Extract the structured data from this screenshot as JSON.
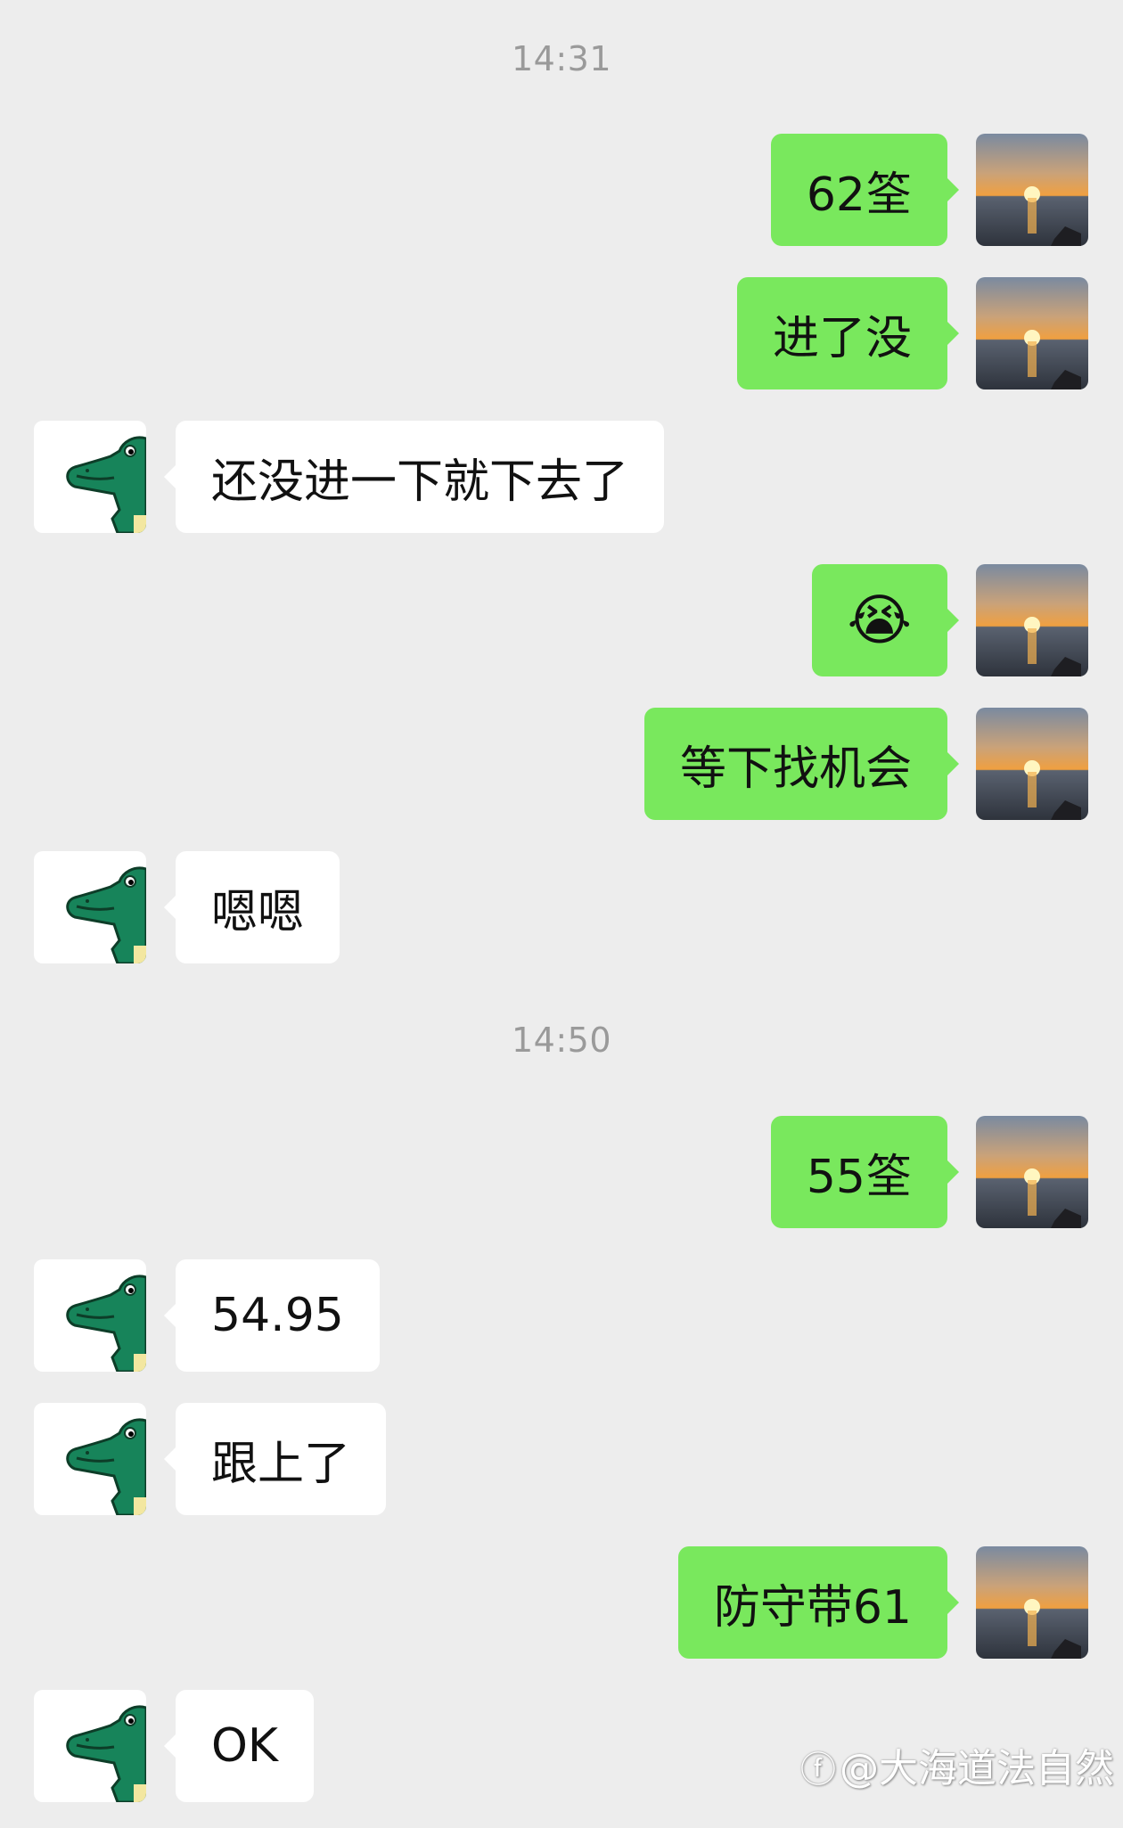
{
  "timestamps": [
    "14:31",
    "14:50"
  ],
  "messages": [
    {
      "side": "out",
      "text": "62筌"
    },
    {
      "side": "out",
      "text": "进了没"
    },
    {
      "side": "in",
      "text": "还没进一下就下去了"
    },
    {
      "side": "out",
      "text": "😭"
    },
    {
      "side": "out",
      "text": "等下找机会"
    },
    {
      "side": "in",
      "text": "嗯嗯"
    },
    {
      "side": "out",
      "text": "55筌"
    },
    {
      "side": "in",
      "text": "54.95"
    },
    {
      "side": "in",
      "text": "跟上了"
    },
    {
      "side": "out",
      "text": "防守带61"
    },
    {
      "side": "in",
      "text": "OK"
    }
  ],
  "watermark": {
    "logo": "ⓕ",
    "text": "@大海道法自然"
  },
  "avatars": {
    "self": "sunset-over-sea-avatar",
    "contact": "green-crocodile-avatar"
  },
  "colors": {
    "background": "#ededed",
    "outgoing_bubble": "#79e85d",
    "incoming_bubble": "#ffffff",
    "timestamp_text": "#9a9a9a"
  }
}
